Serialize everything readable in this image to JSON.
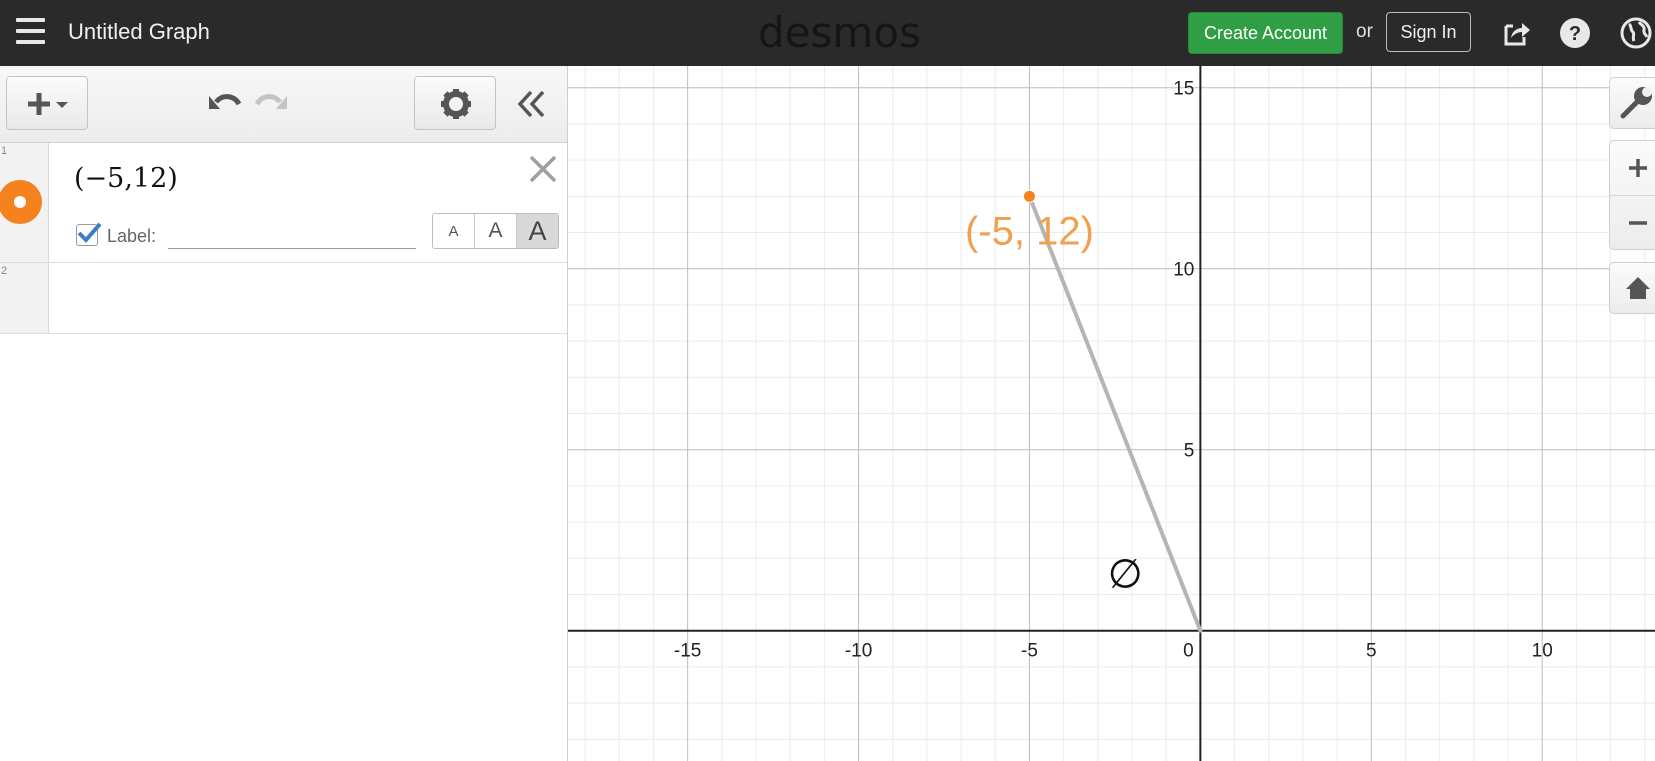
{
  "header": {
    "title": "Untitled Graph",
    "brand": "desmos",
    "create_account_label": "Create Account",
    "or_text": "or",
    "sign_in_label": "Sign In"
  },
  "expressions": [
    {
      "number": "1",
      "latex": "(−5,12)",
      "point_color": "#f5821f",
      "label_checked": true,
      "label_text": "Label:",
      "label_value": "",
      "size_options": [
        "A",
        "A",
        "A"
      ],
      "selected_size": "large"
    },
    {
      "number": "2",
      "latex": ""
    }
  ],
  "graph": {
    "x_ticks": [
      "-15",
      "-10",
      "-5",
      "0",
      "5",
      "10"
    ],
    "y_ticks": [
      "15",
      "10",
      "5"
    ],
    "point_label": "(-5, 12)",
    "angle_label": "∅",
    "point_color": "#f5821f",
    "segment_color": "#b5b5b5"
  },
  "chart_data": {
    "type": "scatter",
    "points": [
      {
        "x": -5,
        "y": 12,
        "label": "(-5, 12)"
      }
    ],
    "segments": [
      {
        "from": [
          -5,
          12
        ],
        "to": [
          0,
          0
        ]
      }
    ],
    "annotations": [
      {
        "text": "∅",
        "x": -2.2,
        "y": 1.2
      }
    ],
    "xlim": [
      -18.5,
      13.3
    ],
    "ylim": [
      -3.6,
      15.6
    ],
    "grid": true,
    "major_step": 5,
    "minor_step": 1
  }
}
